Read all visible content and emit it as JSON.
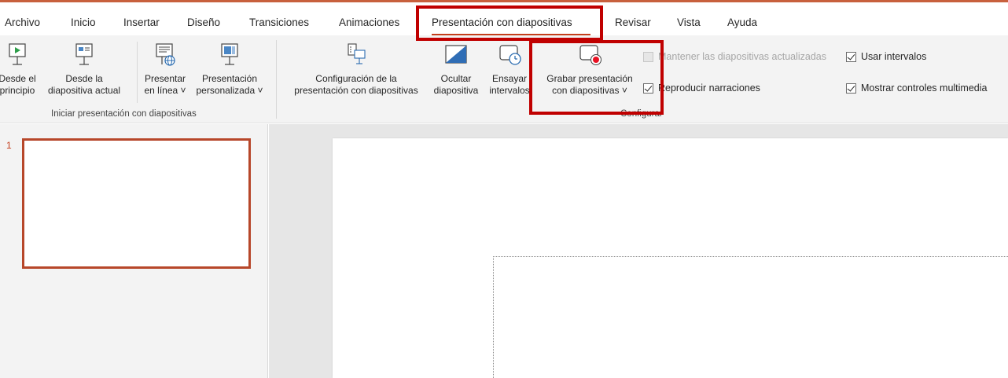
{
  "tabs": [
    {
      "label": "Archivo",
      "active": false
    },
    {
      "label": "Inicio",
      "active": false
    },
    {
      "label": "Insertar",
      "active": false
    },
    {
      "label": "Diseño",
      "active": false
    },
    {
      "label": "Transiciones",
      "active": false
    },
    {
      "label": "Animaciones",
      "active": false
    },
    {
      "label": "Presentación con diapositivas",
      "active": true
    },
    {
      "label": "Revisar",
      "active": false
    },
    {
      "label": "Vista",
      "active": false
    },
    {
      "label": "Ayuda",
      "active": false
    }
  ],
  "ribbon": {
    "start_group": {
      "label": "Iniciar presentación con diapositivas",
      "from_beginning": {
        "line1": "Desde el",
        "line2": "principio"
      },
      "from_current": {
        "line1": "Desde la",
        "line2": "diapositiva actual"
      },
      "present_online": {
        "line1": "Presentar",
        "line2": "en línea ˅"
      },
      "custom_show": {
        "line1": "Presentación",
        "line2": "personalizada ˅"
      }
    },
    "setup_group": {
      "label": "Configurar",
      "setup_show": {
        "line1": "Configuración de la",
        "line2": "presentación con diapositivas"
      },
      "hide_slide": {
        "line1": "Ocultar",
        "line2": "diapositiva"
      },
      "rehearse": {
        "line1": "Ensayar",
        "line2": "intervalos"
      },
      "record": {
        "line1": "Grabar presentación",
        "line2": "con diapositivas ˅"
      },
      "keep_updated": {
        "label": "Mantener las diapositivas actualizadas",
        "checked": false,
        "enabled": false
      },
      "play_narrations": {
        "label": "Reproducir narraciones",
        "checked": true
      },
      "use_timings": {
        "label": "Usar intervalos",
        "checked": true
      },
      "show_media_controls": {
        "label": "Mostrar controles multimedia",
        "checked": true
      }
    }
  },
  "slides": {
    "thumbnail_number": "1"
  },
  "colors": {
    "accent": "#c43e1c",
    "highlight": "#c00000",
    "ribbon_bg": "#f3f3f3",
    "record_dot": "#e81123"
  }
}
